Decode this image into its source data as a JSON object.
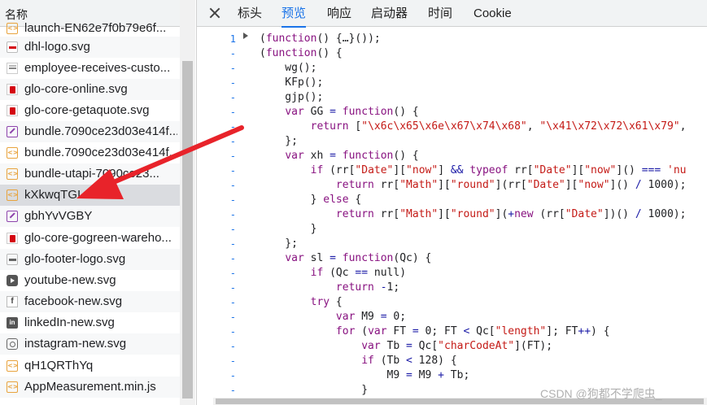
{
  "left_panel": {
    "header": "名称",
    "files": [
      {
        "name": "launch-EN62e7f0b79e6f...",
        "icon": "code-icon"
      },
      {
        "name": "dhl-logo.svg",
        "icon": "svg-logo-icon"
      },
      {
        "name": "employee-receives-custo...",
        "icon": "image-icon"
      },
      {
        "name": "glo-core-online.svg",
        "icon": "image-icon"
      },
      {
        "name": "glo-core-getaquote.svg",
        "icon": "image-icon"
      },
      {
        "name": "bundle.7090ce23d03e414f...",
        "icon": "font-icon"
      },
      {
        "name": "bundle.7090ce23d03e414f...",
        "icon": "code-icon"
      },
      {
        "name": "bundle-utapi-7090ce23...",
        "icon": "code-icon"
      },
      {
        "name": "kXkwqTGI",
        "icon": "code-icon",
        "selected": true
      },
      {
        "name": "gbhYvVGBY",
        "icon": "font-icon"
      },
      {
        "name": "glo-core-gogreen-wareho...",
        "icon": "image-icon"
      },
      {
        "name": "glo-footer-logo.svg",
        "icon": "svg-logo-icon"
      },
      {
        "name": "youtube-new.svg",
        "icon": "youtube-icon"
      },
      {
        "name": "facebook-new.svg",
        "icon": "facebook-icon"
      },
      {
        "name": "linkedIn-new.svg",
        "icon": "linkedin-icon"
      },
      {
        "name": "instagram-new.svg",
        "icon": "instagram-icon"
      },
      {
        "name": "qH1QRThYq",
        "icon": "code-icon"
      },
      {
        "name": "AppMeasurement.min.js",
        "icon": "code-icon"
      }
    ]
  },
  "tabs": [
    "标头",
    "预览",
    "响应",
    "启动器",
    "时间",
    "Cookie"
  ],
  "active_tab": "预览",
  "code_lines": [
    {
      "num": "1",
      "text": "(function() {…}());"
    },
    {
      "num": "-",
      "text": "(function() {"
    },
    {
      "num": "-",
      "text": "    wg();"
    },
    {
      "num": "-",
      "text": "    KFp();"
    },
    {
      "num": "-",
      "text": "    gjp();"
    },
    {
      "num": "-",
      "text": "    var GG = function() {"
    },
    {
      "num": "-",
      "text": "        return [\"\\x6c\\x65\\x6e\\x67\\x74\\x68\", \"\\x41\\x72\\x72\\x61\\x79\","
    },
    {
      "num": "-",
      "text": "    };"
    },
    {
      "num": "-",
      "text": "    var xh = function() {"
    },
    {
      "num": "-",
      "text": "        if (rr[\"Date\"][\"now\"] && typeof rr[\"Date\"][\"now\"]() === 'nu"
    },
    {
      "num": "-",
      "text": "            return rr[\"Math\"][\"round\"](rr[\"Date\"][\"now\"]() / 1000);"
    },
    {
      "num": "-",
      "text": "        } else {"
    },
    {
      "num": "-",
      "text": "            return rr[\"Math\"][\"round\"](+new (rr[\"Date\"])() / 1000);"
    },
    {
      "num": "-",
      "text": "        }"
    },
    {
      "num": "-",
      "text": "    };"
    },
    {
      "num": "-",
      "text": "    var sl = function(Qc) {"
    },
    {
      "num": "-",
      "text": "        if (Qc == null)"
    },
    {
      "num": "-",
      "text": "            return -1;"
    },
    {
      "num": "-",
      "text": "        try {"
    },
    {
      "num": "-",
      "text": "            var M9 = 0;"
    },
    {
      "num": "-",
      "text": "            for (var FT = 0; FT < Qc[\"length\"]; FT++) {"
    },
    {
      "num": "-",
      "text": "                var Tb = Qc[\"charCodeAt\"](FT);"
    },
    {
      "num": "-",
      "text": "                if (Tb < 128) {"
    },
    {
      "num": "-",
      "text": "                    M9 = M9 + Tb;"
    },
    {
      "num": "-",
      "text": "                }"
    }
  ],
  "watermark": "CSDN @狗都不学爬虫_",
  "colors": {
    "accent": "#1a73e8",
    "arrow": "#e8232a",
    "keyword": "#881280",
    "string": "#c41a16"
  }
}
